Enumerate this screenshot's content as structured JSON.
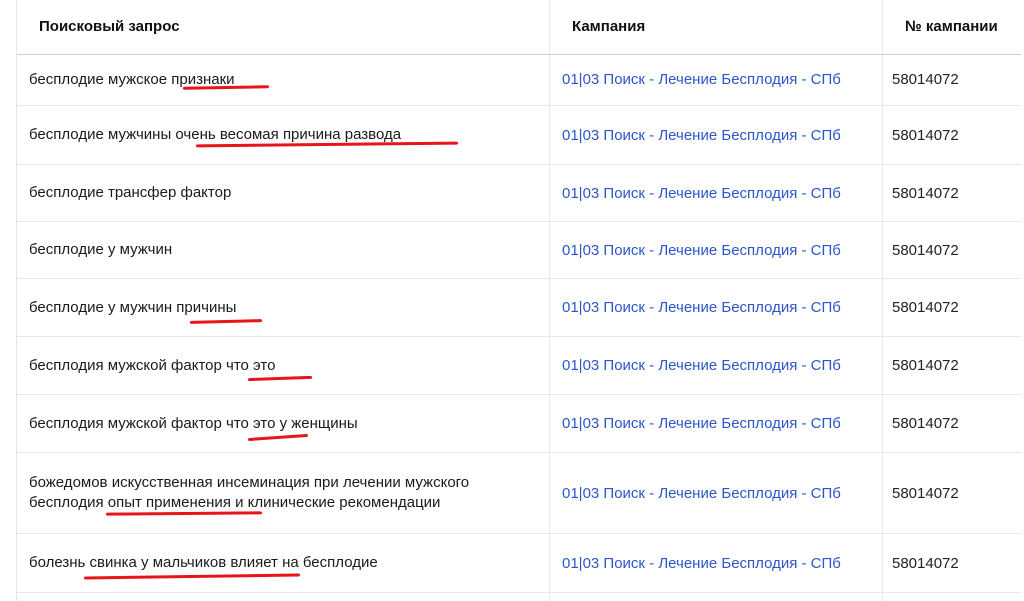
{
  "columns": {
    "query": "Поисковый запрос",
    "campaign": "Кампания",
    "campaign_no": "№ кампании"
  },
  "rows": [
    {
      "query": "бесплодие мужское признаки",
      "campaign": "01|03 Поиск - Лечение Бесплодия - СПб",
      "campaign_no": "58014072"
    },
    {
      "query": "бесплодие мужчины очень весомая причина развода",
      "campaign": "01|03 Поиск - Лечение Бесплодия - СПб",
      "campaign_no": "58014072"
    },
    {
      "query": "бесплодие трансфер фактор",
      "campaign": "01|03 Поиск - Лечение Бесплодия - СПб",
      "campaign_no": "58014072"
    },
    {
      "query": "бесплодие у мужчин",
      "campaign": "01|03 Поиск - Лечение Бесплодия - СПб",
      "campaign_no": "58014072"
    },
    {
      "query": "бесплодие у мужчин причины",
      "campaign": "01|03 Поиск - Лечение Бесплодия - СПб",
      "campaign_no": "58014072"
    },
    {
      "query": "бесплодия мужской фактор что это",
      "campaign": "01|03 Поиск - Лечение Бесплодия - СПб",
      "campaign_no": "58014072"
    },
    {
      "query": "бесплодия мужской фактор что это у женщины",
      "campaign": "01|03 Поиск - Лечение Бесплодия - СПб",
      "campaign_no": "58014072"
    },
    {
      "query_line1": "божедомов искусственная инсеминация при лечении мужского",
      "query_line2": "бесплодия опыт применения и клинические рекомендации",
      "campaign": "01|03 Поиск - Лечение Бесплодия - СПб",
      "campaign_no": "58014072"
    },
    {
      "query": "болезнь свинка у мальчиков влияет на бесплодие",
      "campaign": "01|03 Поиск - Лечение Бесплодия - СПб",
      "campaign_no": "58014072"
    }
  ],
  "colors": {
    "link": "#2c56c9",
    "annotation_underline": "#e8141c"
  }
}
